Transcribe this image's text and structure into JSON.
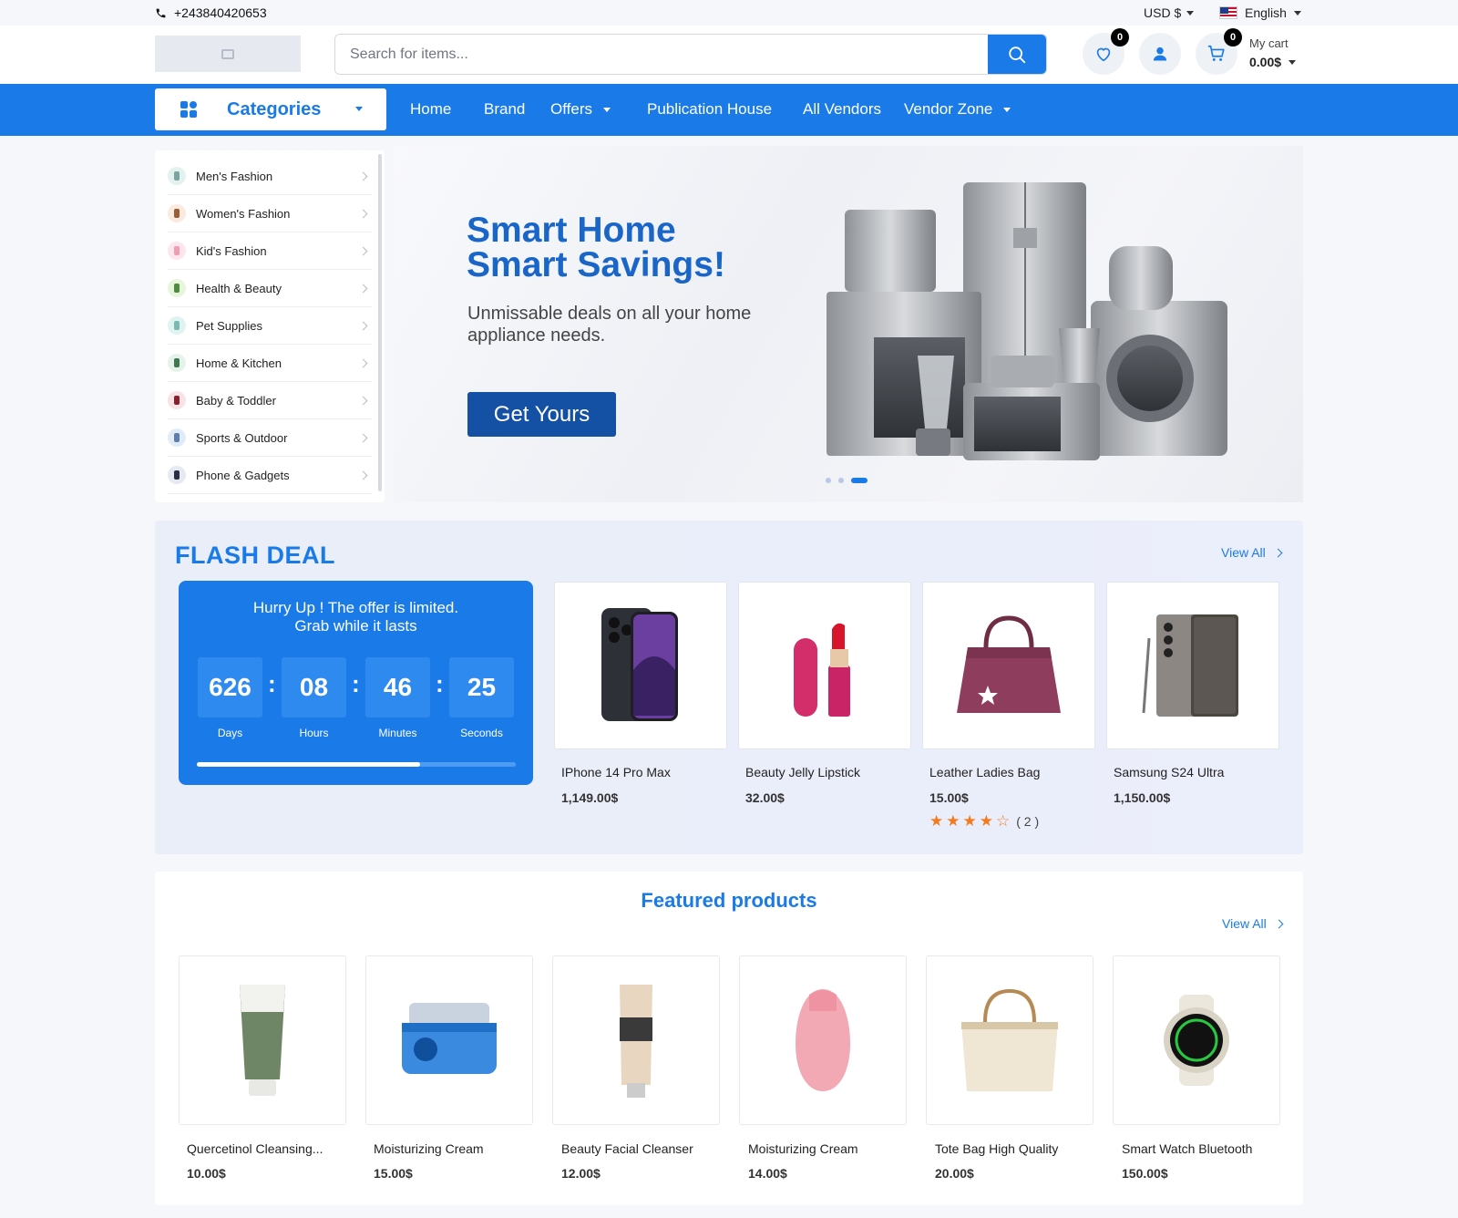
{
  "topbar": {
    "phone": "+243840420653",
    "currency": "USD $",
    "language": "English"
  },
  "header": {
    "search_placeholder": "Search for items...",
    "wishlist_count": "0",
    "cart_count": "0",
    "cart_label": "My cart",
    "cart_total": "0.00$"
  },
  "nav": {
    "categories": "Categories",
    "links": [
      "Home",
      "Brand",
      "Offers",
      "Publication House",
      "All Vendors",
      "Vendor Zone"
    ]
  },
  "sidebar": {
    "items": [
      "Men's Fashion",
      "Women's Fashion",
      "Kid's Fashion",
      "Health & Beauty",
      "Pet Supplies",
      "Home & Kitchen",
      "Baby & Toddler",
      "Sports & Outdoor",
      "Phone & Gadgets"
    ]
  },
  "banner": {
    "title_line1": "Smart Home",
    "title_line2": "Smart Savings!",
    "subtitle": "Unmissable deals on all your home appliance needs.",
    "cta": "Get Yours",
    "active_slide": 3,
    "slide_count": 3
  },
  "flash": {
    "title": "FLASH DEAL",
    "view_all": "View All",
    "message_line1": "Hurry Up ! The offer is limited.",
    "message_line2": "Grab while it lasts",
    "timer": [
      {
        "value": "626",
        "label": "Days"
      },
      {
        "value": "08",
        "label": "Hours"
      },
      {
        "value": "46",
        "label": "Minutes"
      },
      {
        "value": "25",
        "label": "Seconds"
      }
    ],
    "progress": 0.7,
    "products": [
      {
        "name": "IPhone 14 Pro Max",
        "price": "1,149.00$",
        "icon": "phone-image"
      },
      {
        "name": "Beauty Jelly Lipstick",
        "price": "32.00$",
        "icon": "lipstick-image"
      },
      {
        "name": "Leather Ladies Bag",
        "price": "15.00$",
        "icon": "handbag-image",
        "rating": 4.5,
        "reviews": "( 2 )"
      },
      {
        "name": "Samsung S24 Ultra",
        "price": "1,150.00$",
        "icon": "phone-image"
      }
    ]
  },
  "featured": {
    "title": "Featured products",
    "view_all": "View All",
    "products": [
      {
        "name": "Quercetinol Cleansing...",
        "price": "10.00$"
      },
      {
        "name": "Moisturizing Cream",
        "price": "15.00$"
      },
      {
        "name": "Beauty Facial Cleanser",
        "price": "12.00$"
      },
      {
        "name": "Moisturizing Cream",
        "price": "14.00$"
      },
      {
        "name": "Tote Bag High Quality",
        "price": "20.00$"
      },
      {
        "name": "Smart Watch Bluetooth",
        "price": "150.00$"
      }
    ]
  },
  "colors": {
    "primary": "#1a7be8",
    "dark_primary": "#1450a3",
    "star": "#f47a1f"
  }
}
